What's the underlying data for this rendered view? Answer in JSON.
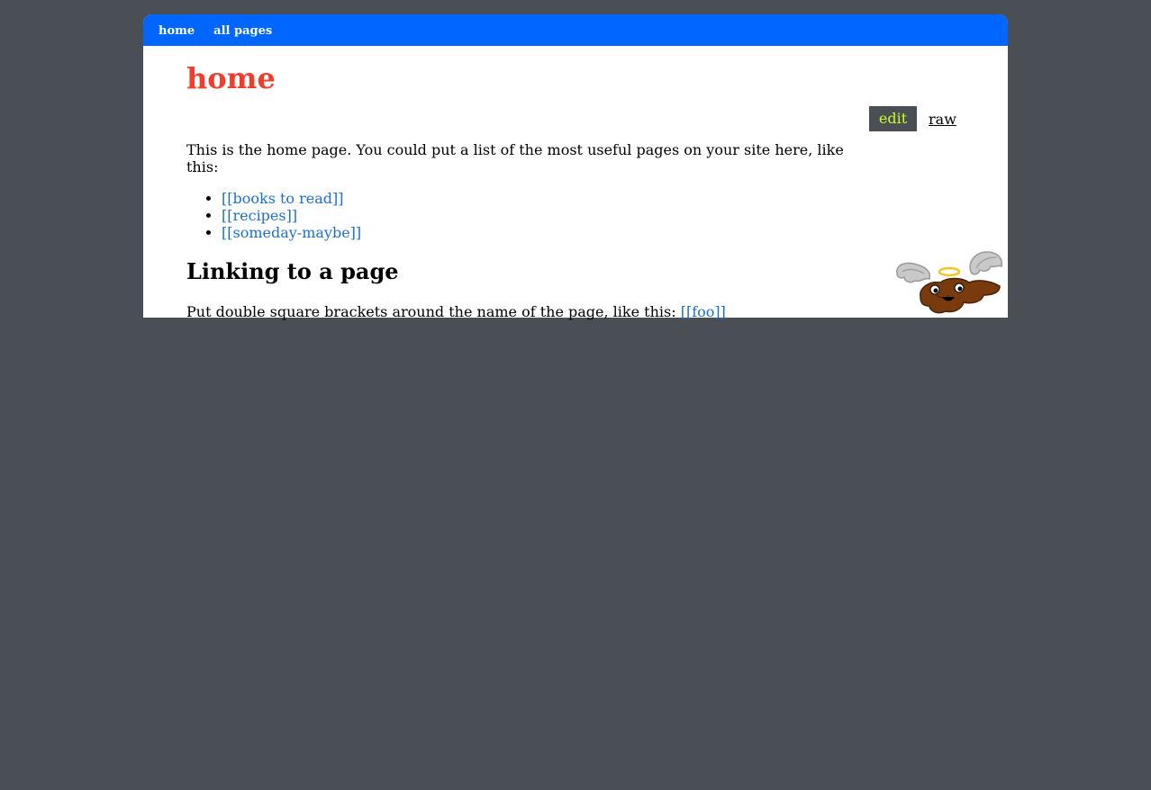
{
  "nav": {
    "items": [
      {
        "label": "home"
      },
      {
        "label": "all pages"
      }
    ]
  },
  "page": {
    "title": "home",
    "actions": {
      "edit_label": "edit",
      "raw_label": "raw"
    },
    "intro": "This is the home page. You could put a list of the most useful pages on your site here, like this:",
    "links": [
      {
        "label": "[[books to read]]"
      },
      {
        "label": "[[recipes]]"
      },
      {
        "label": "[[someday-maybe]]"
      }
    ],
    "section": {
      "heading": "Linking to a page",
      "text": "Put double square brackets around the name of the page, like this: ",
      "example_link": "[[foo]]"
    }
  },
  "colors": {
    "background": "#4a4e55",
    "navbar": "#0066ff",
    "title": "#f23c2c",
    "link": "#1a6fd4",
    "edit_text": "#ccff22"
  },
  "icons": {
    "mascot": "winged-angel-poop-mascot"
  }
}
